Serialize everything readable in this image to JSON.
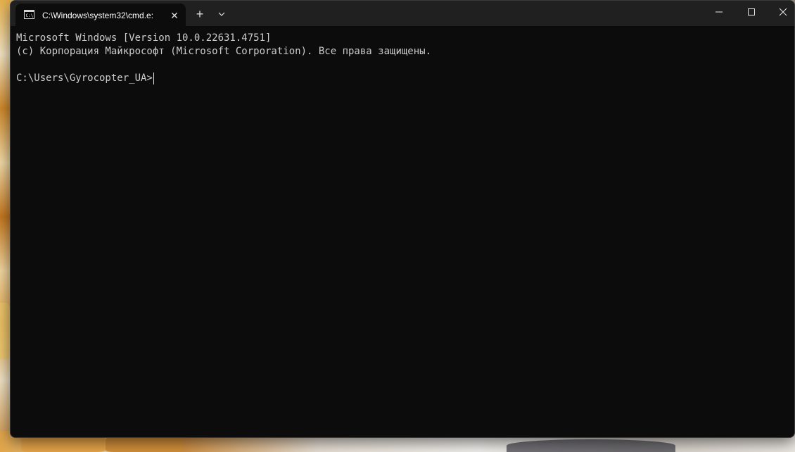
{
  "tab": {
    "title": "C:\\Windows\\system32\\cmd.e:",
    "close_glyph": "✕",
    "icon": "cmd-icon"
  },
  "toolbar": {
    "new_tab_glyph": "+",
    "dropdown_icon": "chevron-down-icon"
  },
  "window_controls": {
    "minimize_icon": "minimize-icon",
    "maximize_icon": "maximize-icon",
    "close_icon": "close-icon"
  },
  "terminal": {
    "lines": [
      "Microsoft Windows [Version 10.0.22631.4751]",
      "(c) Корпорация Майкрософт (Microsoft Corporation). Все права защищены."
    ],
    "prompt": "C:\\Users\\Gyrocopter_UA>"
  },
  "colors": {
    "terminal_bg": "#0c0c0c",
    "titlebar_bg": "#202020",
    "text": "#cccccc"
  }
}
